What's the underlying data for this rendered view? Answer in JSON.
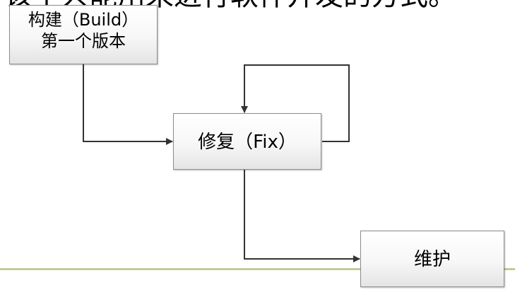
{
  "header": {
    "cutoff_text": "该不只能用来进行软件开发的方式。"
  },
  "nodes": {
    "build": {
      "line1": "构建（Build）",
      "line2": "第一个版本"
    },
    "fix": {
      "label": "修复（Fix）"
    },
    "maintain": {
      "label": "维护"
    }
  },
  "colors": {
    "line": "#333333",
    "rule": "#c5c99a",
    "box_border": "#8c8c8c"
  }
}
